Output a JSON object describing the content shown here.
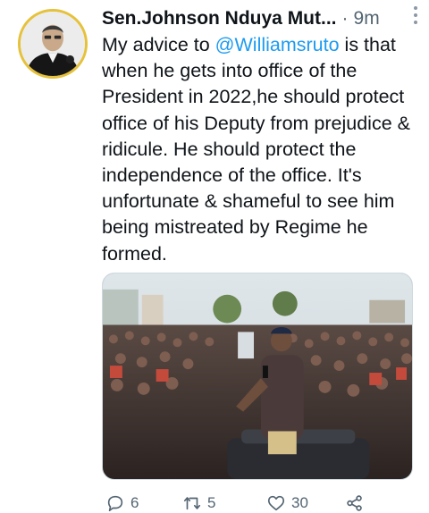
{
  "author": {
    "display_name": "Sen.Johnson Nduya Mut...",
    "separator": "·",
    "time": "9m"
  },
  "tweet": {
    "text_before_mention": "My advice to ",
    "mention": "@Williamsruto",
    "text_after_mention": " is that when he gets into office of the President in 2022,he should protect office of his Deputy from prejudice & ridicule. He should protect the independence of the  office. It's unfortunate & shameful to see him being mistreated by Regime he formed."
  },
  "actions": {
    "reply_count": "6",
    "retweet_count": "5",
    "like_count": "30"
  },
  "icons": {
    "more": "more-vertical-icon",
    "reply": "reply-icon",
    "retweet": "retweet-icon",
    "like": "heart-icon",
    "share": "share-icon"
  },
  "colors": {
    "mention": "#1d9bf0",
    "secondary_text": "#536471",
    "avatar_ring": "#e6c13a"
  }
}
